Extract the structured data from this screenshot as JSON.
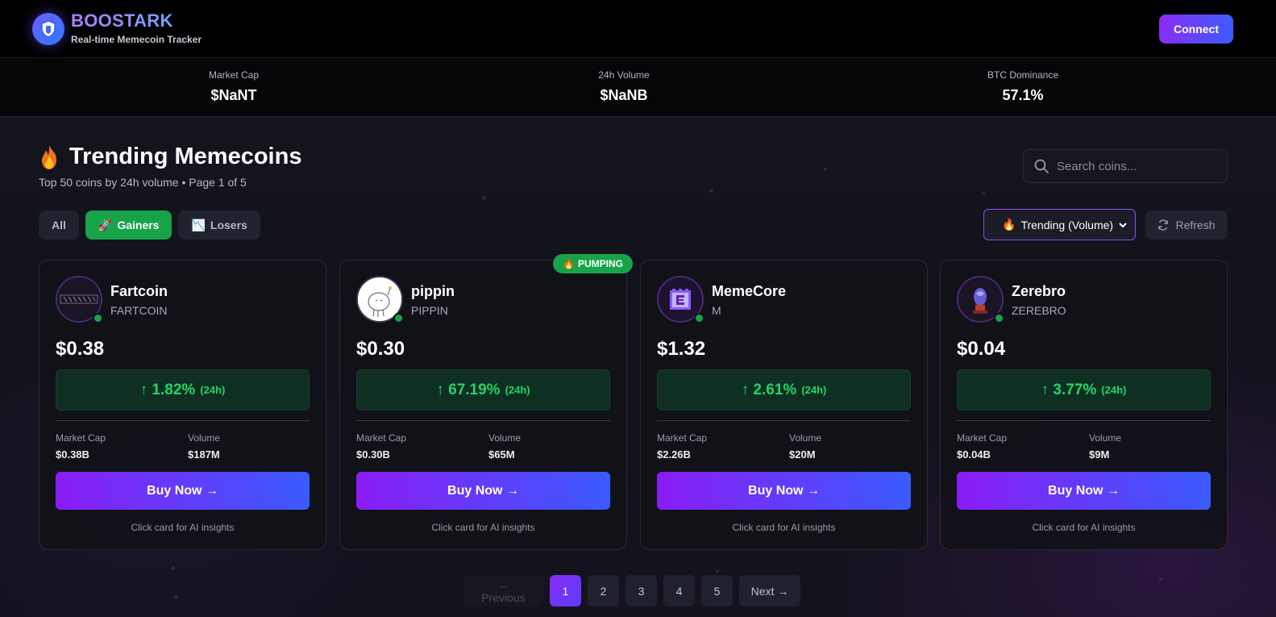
{
  "header": {
    "brand_title": "BOOSTARK",
    "brand_subtitle": "Real-time Memecoin Tracker",
    "connect_label": "Connect"
  },
  "stats": [
    {
      "label": "Market Cap",
      "value": "$NaNT"
    },
    {
      "label": "24h Volume",
      "value": "$NaNB"
    },
    {
      "label": "BTC Dominance",
      "value": "57.1%"
    }
  ],
  "main": {
    "title": "Trending Memecoins",
    "subtitle": "Top 50 coins by 24h volume • Page 1 of 5",
    "search_placeholder": "Search coins..."
  },
  "filters": [
    {
      "label": "All",
      "icon": "",
      "active": false
    },
    {
      "label": "Gainers",
      "icon": "rocket-icon",
      "active": true
    },
    {
      "label": "Losers",
      "icon": "chart-down-icon",
      "active": false
    }
  ],
  "sort": {
    "selected": "Trending (Volume)"
  },
  "refresh_label": "Refresh",
  "cards": [
    {
      "name": "Fartcoin",
      "symbol": "FARTCOIN",
      "price": "$0.38",
      "change": "↑ 1.82%",
      "period": "(24h)",
      "market_cap_label": "Market Cap",
      "market_cap": "$0.38B",
      "volume_label": "Volume",
      "volume": "$187M",
      "buy_label": "Buy Now →",
      "hint": "Click card for AI insights",
      "badge": ""
    },
    {
      "name": "pippin",
      "symbol": "PIPPIN",
      "price": "$0.30",
      "change": "↑ 67.19%",
      "period": "(24h)",
      "market_cap_label": "Market Cap",
      "market_cap": "$0.30B",
      "volume_label": "Volume",
      "volume": "$65M",
      "buy_label": "Buy Now →",
      "hint": "Click card for AI insights",
      "badge": "PUMPING"
    },
    {
      "name": "MemeCore",
      "symbol": "M",
      "price": "$1.32",
      "change": "↑ 2.61%",
      "period": "(24h)",
      "market_cap_label": "Market Cap",
      "market_cap": "$2.26B",
      "volume_label": "Volume",
      "volume": "$20M",
      "buy_label": "Buy Now →",
      "hint": "Click card for AI insights",
      "badge": ""
    },
    {
      "name": "Zerebro",
      "symbol": "ZEREBRO",
      "price": "$0.04",
      "change": "↑ 3.77%",
      "period": "(24h)",
      "market_cap_label": "Market Cap",
      "market_cap": "$0.04B",
      "volume_label": "Volume",
      "volume": "$9M",
      "buy_label": "Buy Now →",
      "hint": "Click card for AI insights",
      "badge": ""
    }
  ],
  "pagination": {
    "prev_label": "← Previous",
    "pages": [
      "1",
      "2",
      "3",
      "4",
      "5"
    ],
    "current": "1",
    "next_label": "Next →"
  },
  "colors": {
    "accent_purple": "#8a2cf5",
    "accent_blue": "#3d5cff",
    "positive_green": "#22d469",
    "badge_green": "#17a34a"
  }
}
